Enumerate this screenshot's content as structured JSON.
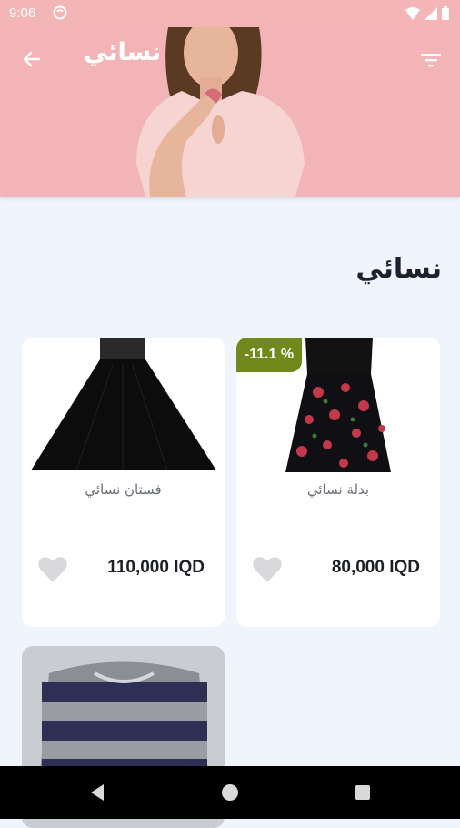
{
  "status_bar": {
    "time": "9:06"
  },
  "header": {
    "title": "نسائي",
    "back_icon": "arrow-back-icon",
    "filter_icon": "filter-icon"
  },
  "section": {
    "title": "نسائي"
  },
  "products": [
    {
      "name": "بدلة نسائي",
      "price": "80,000 IQD",
      "discount": "-11.1 %"
    },
    {
      "name": "فستان نسائي",
      "price": "110,000 IQD"
    },
    {
      "name": ""
    }
  ],
  "colors": {
    "header_bg": "#f3b4b7",
    "badge_bg": "#6f8a1b",
    "page_bg": "#f0f5fd"
  }
}
